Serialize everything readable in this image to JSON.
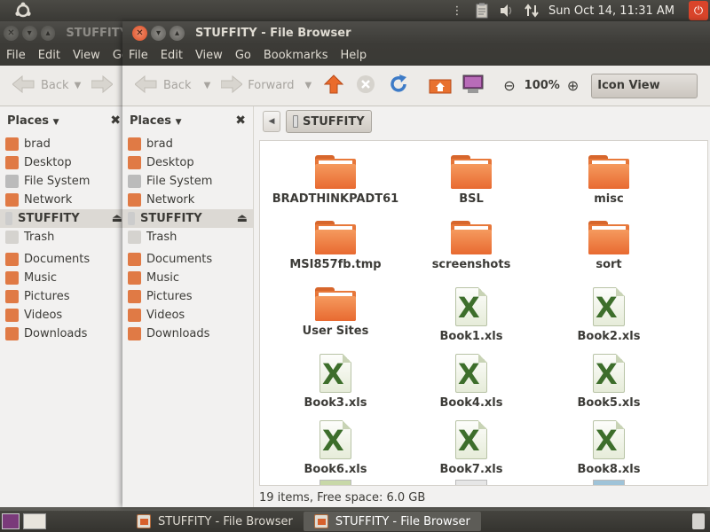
{
  "top_panel": {
    "clock": "Sun Oct 14, 11:31 AM"
  },
  "back_window": {
    "title": "STUFFITY",
    "menu": [
      "File",
      "Edit",
      "View",
      "Go"
    ],
    "toolbar": {
      "back": "Back"
    },
    "places_header": "Places",
    "places": [
      "brad",
      "Desktop",
      "File System",
      "Network",
      "STUFFITY",
      "Trash"
    ],
    "bookmarks": [
      "Documents",
      "Music",
      "Pictures",
      "Videos",
      "Downloads"
    ]
  },
  "front_window": {
    "title": "STUFFITY - File Browser",
    "menu": [
      "File",
      "Edit",
      "View",
      "Go",
      "Bookmarks",
      "Help"
    ],
    "toolbar": {
      "back": "Back",
      "forward": "Forward",
      "zoom": "100%",
      "view_mode": "Icon View"
    },
    "places_header": "Places",
    "places": [
      "brad",
      "Desktop",
      "File System",
      "Network",
      "STUFFITY",
      "Trash"
    ],
    "bookmarks": [
      "Documents",
      "Music",
      "Pictures",
      "Videos",
      "Downloads"
    ],
    "pathbar": {
      "current": "STUFFITY"
    },
    "files": [
      {
        "name": "BRADTHINKPADT61",
        "type": "folder"
      },
      {
        "name": "BSL",
        "type": "folder"
      },
      {
        "name": "misc",
        "type": "folder"
      },
      {
        "name": "MSI857fb.tmp",
        "type": "folder"
      },
      {
        "name": "screenshots",
        "type": "folder"
      },
      {
        "name": "sort",
        "type": "folder"
      },
      {
        "name": "User Sites",
        "type": "folder"
      },
      {
        "name": "Book1.xls",
        "type": "xls"
      },
      {
        "name": "Book2.xls",
        "type": "xls"
      },
      {
        "name": "Book3.xls",
        "type": "xls"
      },
      {
        "name": "Book4.xls",
        "type": "xls"
      },
      {
        "name": "Book5.xls",
        "type": "xls"
      },
      {
        "name": "Book6.xls",
        "type": "xls"
      },
      {
        "name": "Book7.xls",
        "type": "xls"
      },
      {
        "name": "Book8.xls",
        "type": "xls"
      }
    ],
    "status": "19 items, Free space: 6.0 GB"
  },
  "taskbar": [
    {
      "label": "STUFFITY - File Browser",
      "active": false
    },
    {
      "label": "STUFFITY - File Browser",
      "active": true
    }
  ],
  "colors": {
    "accent": "#dd4814",
    "folder": "#e8742f",
    "excel": "#3d6e2b"
  }
}
